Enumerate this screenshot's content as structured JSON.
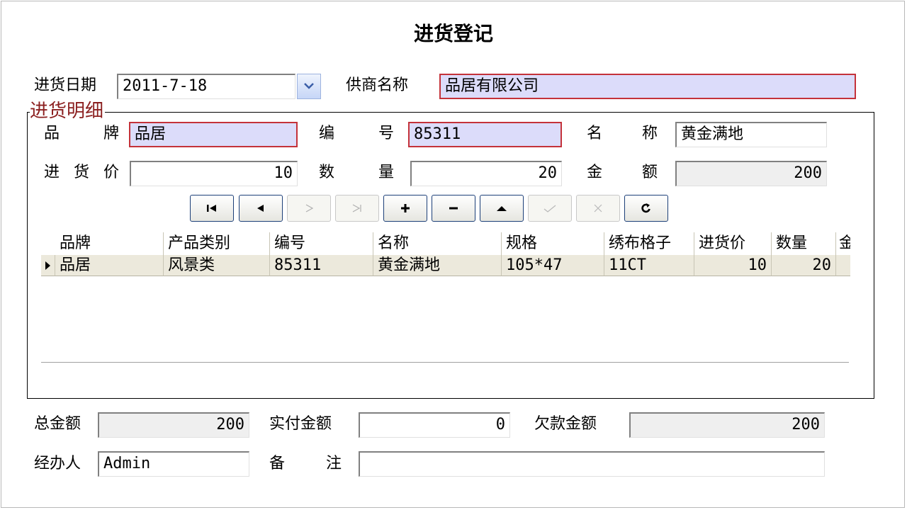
{
  "window": {
    "title": "进货登记"
  },
  "header": {
    "date_label": "进货日期",
    "date_value": "2011-7-18",
    "supplier_label": "供商名称",
    "supplier_value": "品居有限公司"
  },
  "detail": {
    "group_title": "进货明细",
    "brand_label_1": "品",
    "brand_label_2": "牌",
    "brand_value": "品居",
    "code_label_1": "编",
    "code_label_2": "号",
    "code_value": "85311",
    "name_label_1": "名",
    "name_label_2": "称",
    "name_value": "黄金满地",
    "price_label_1": "进",
    "price_label_2": "货",
    "price_label_3": "价",
    "price_value": "10",
    "qty_label_1": "数",
    "qty_label_2": "量",
    "qty_value": "20",
    "amount_label_1": "金",
    "amount_label_2": "额",
    "amount_value": "200"
  },
  "navigator": {
    "buttons": [
      {
        "name": "first-record",
        "enabled": true
      },
      {
        "name": "prior-record",
        "enabled": true
      },
      {
        "name": "next-record",
        "enabled": false
      },
      {
        "name": "last-record",
        "enabled": false
      },
      {
        "name": "insert-record",
        "enabled": true
      },
      {
        "name": "delete-record",
        "enabled": true
      },
      {
        "name": "edit-record",
        "enabled": true
      },
      {
        "name": "post-record",
        "enabled": false
      },
      {
        "name": "cancel-record",
        "enabled": false
      },
      {
        "name": "refresh-records",
        "enabled": true
      }
    ]
  },
  "grid": {
    "columns": [
      "品牌",
      "产品类别",
      "编号",
      "名称",
      "规格",
      "绣布格子",
      "进货价",
      "数量",
      "金"
    ],
    "rows": [
      [
        "品居",
        "风景类",
        "85311",
        "黄金满地",
        "105*47",
        "11CT",
        "10",
        "20",
        ""
      ]
    ]
  },
  "footer": {
    "total_label": "总金额",
    "total_value": "200",
    "paid_label": "实付金额",
    "paid_value": "0",
    "owed_label": "欠款金额",
    "owed_value": "200",
    "operator_label": "经办人",
    "operator_value": "Admin",
    "remark_label_1": "备",
    "remark_label_2": "注",
    "remark_value": ""
  },
  "colors": {
    "required_border": "#c4323a",
    "required_fill": "#dcdcfa",
    "readonly_fill": "#efefef",
    "legend_text": "#8b1f1f",
    "selected_row": "#ece9dc"
  }
}
